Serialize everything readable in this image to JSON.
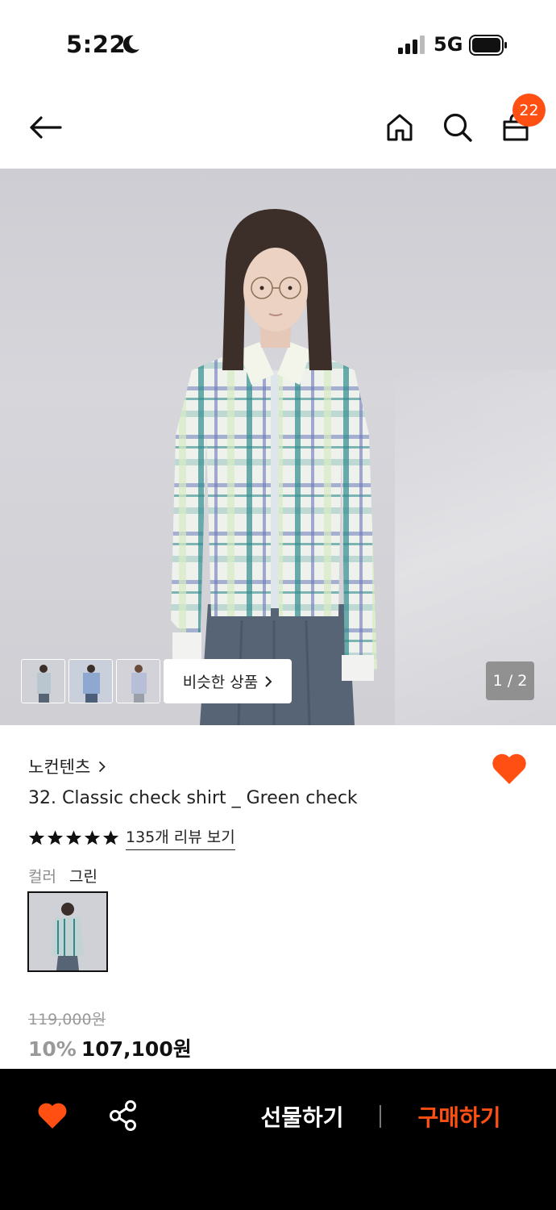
{
  "status_bar": {
    "time": "5:22",
    "network": "5G"
  },
  "nav": {
    "cart_count": "22"
  },
  "hero": {
    "similar_label": "비슷한 상품",
    "counter": "1 / 2",
    "thumbnails": [
      "thumb-1",
      "thumb-2",
      "thumb-3"
    ]
  },
  "product": {
    "brand": "노컨텐츠",
    "title": "32. Classic check shirt _ Green check",
    "rating_stars": 5,
    "review_link": "135개 리뷰 보기",
    "color_label": "컬러",
    "color_value": "그린",
    "original_price": "119,000원",
    "discount": "10%",
    "sale_price": "107,100원"
  },
  "bottom_bar": {
    "gift_label": "선물하기",
    "buy_label": "구매하기"
  },
  "colors": {
    "accent": "#ff4f12",
    "bottom_bar": "#000000"
  },
  "icons": [
    "moon-icon",
    "signal-icon",
    "battery-icon",
    "back-arrow-icon",
    "home-icon",
    "search-icon",
    "shopping-bag-icon",
    "chevron-right-icon",
    "heart-icon",
    "star-icon",
    "share-icon"
  ]
}
